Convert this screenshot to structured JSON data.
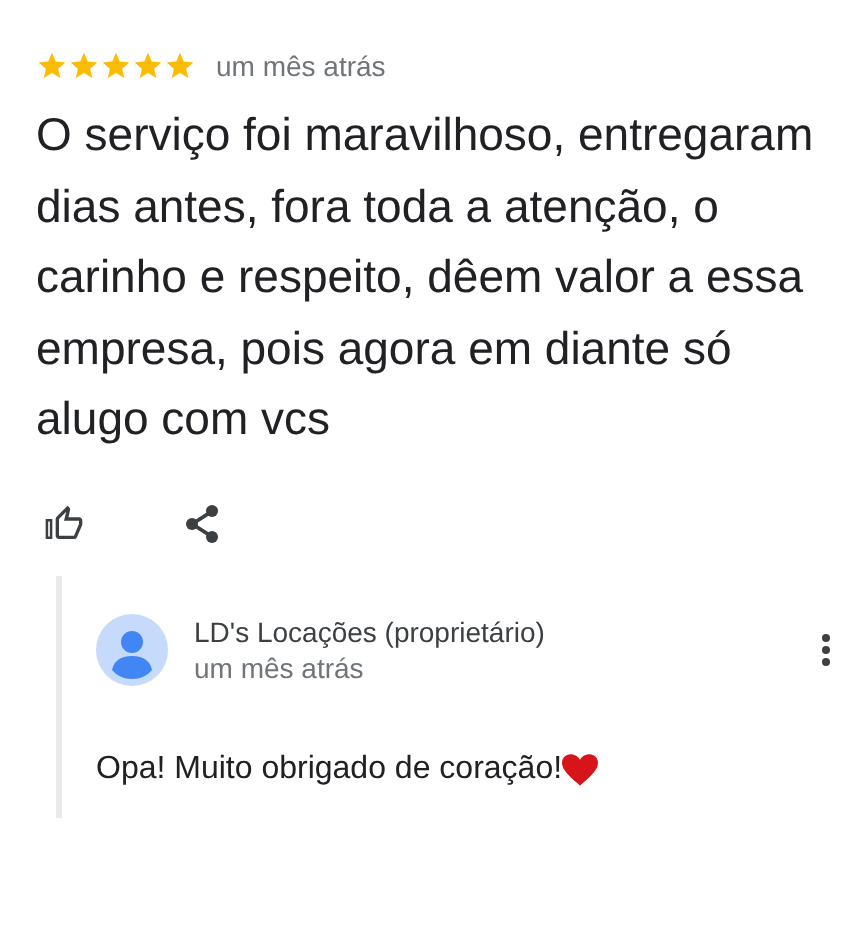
{
  "review": {
    "stars": 5,
    "time": "um mês atrás",
    "text": "O serviço foi maravilhoso, entregaram dias antes, fora toda a atenção, o carinho e respeito, dêem valor a essa empresa, pois agora em diante só alugo com vcs"
  },
  "owner_reply": {
    "name": "LD's Locações (proprietário)",
    "time": "um mês atrás",
    "text": "Opa! Muito obrigado de coração!"
  }
}
